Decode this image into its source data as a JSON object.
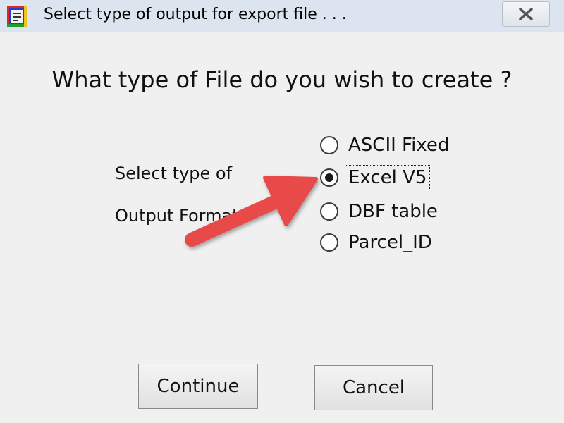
{
  "window": {
    "title": "Select type of output for export file . . .",
    "app_icon": "app-icon",
    "close_icon": "close-x-icon"
  },
  "dialog": {
    "question": "What type of File do you wish to create ?",
    "group_label_line1": "Select type of",
    "group_label_line2": "Output Format",
    "options": [
      {
        "label": "ASCII Fixed",
        "checked": false
      },
      {
        "label": "Excel V5",
        "checked": true
      },
      {
        "label": "DBF table",
        "checked": false
      },
      {
        "label": "Parcel_ID",
        "checked": false
      }
    ],
    "continue_label": "Continue",
    "cancel_label": "Cancel"
  },
  "annotation": {
    "arrow_color": "#e84a4a",
    "arrow_icon": "pointer-arrow-icon"
  }
}
